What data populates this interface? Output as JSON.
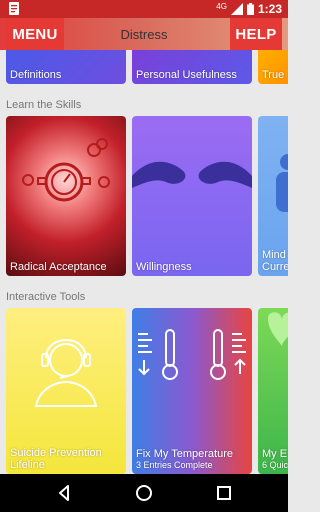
{
  "status_bar": {
    "network": "4G",
    "time": "1:23"
  },
  "header": {
    "menu_label": "MENU",
    "title": "Distress",
    "help_label": "HELP"
  },
  "top_row": [
    {
      "label": "Definitions",
      "color": "#5a57e6"
    },
    {
      "label": "Personal Usefulness",
      "color": "#6b4fd8"
    },
    {
      "label": "True",
      "color": "#ffa000"
    }
  ],
  "sections": {
    "skills": "Learn the Skills",
    "tools": "Interactive Tools"
  },
  "skills": [
    {
      "label": "Radical Acceptance"
    },
    {
      "label": "Willingness"
    },
    {
      "label": "Mind",
      "label2": "Curre"
    }
  ],
  "tools": [
    {
      "label": "Suicide Prevention",
      "label2": "Lifeline"
    },
    {
      "label": "Fix My Temperature",
      "sub": "3 Entries Complete"
    },
    {
      "label": "My E",
      "sub": "6 Quic"
    }
  ],
  "colors": {
    "accent": "#e53935",
    "status": "#c62828"
  }
}
